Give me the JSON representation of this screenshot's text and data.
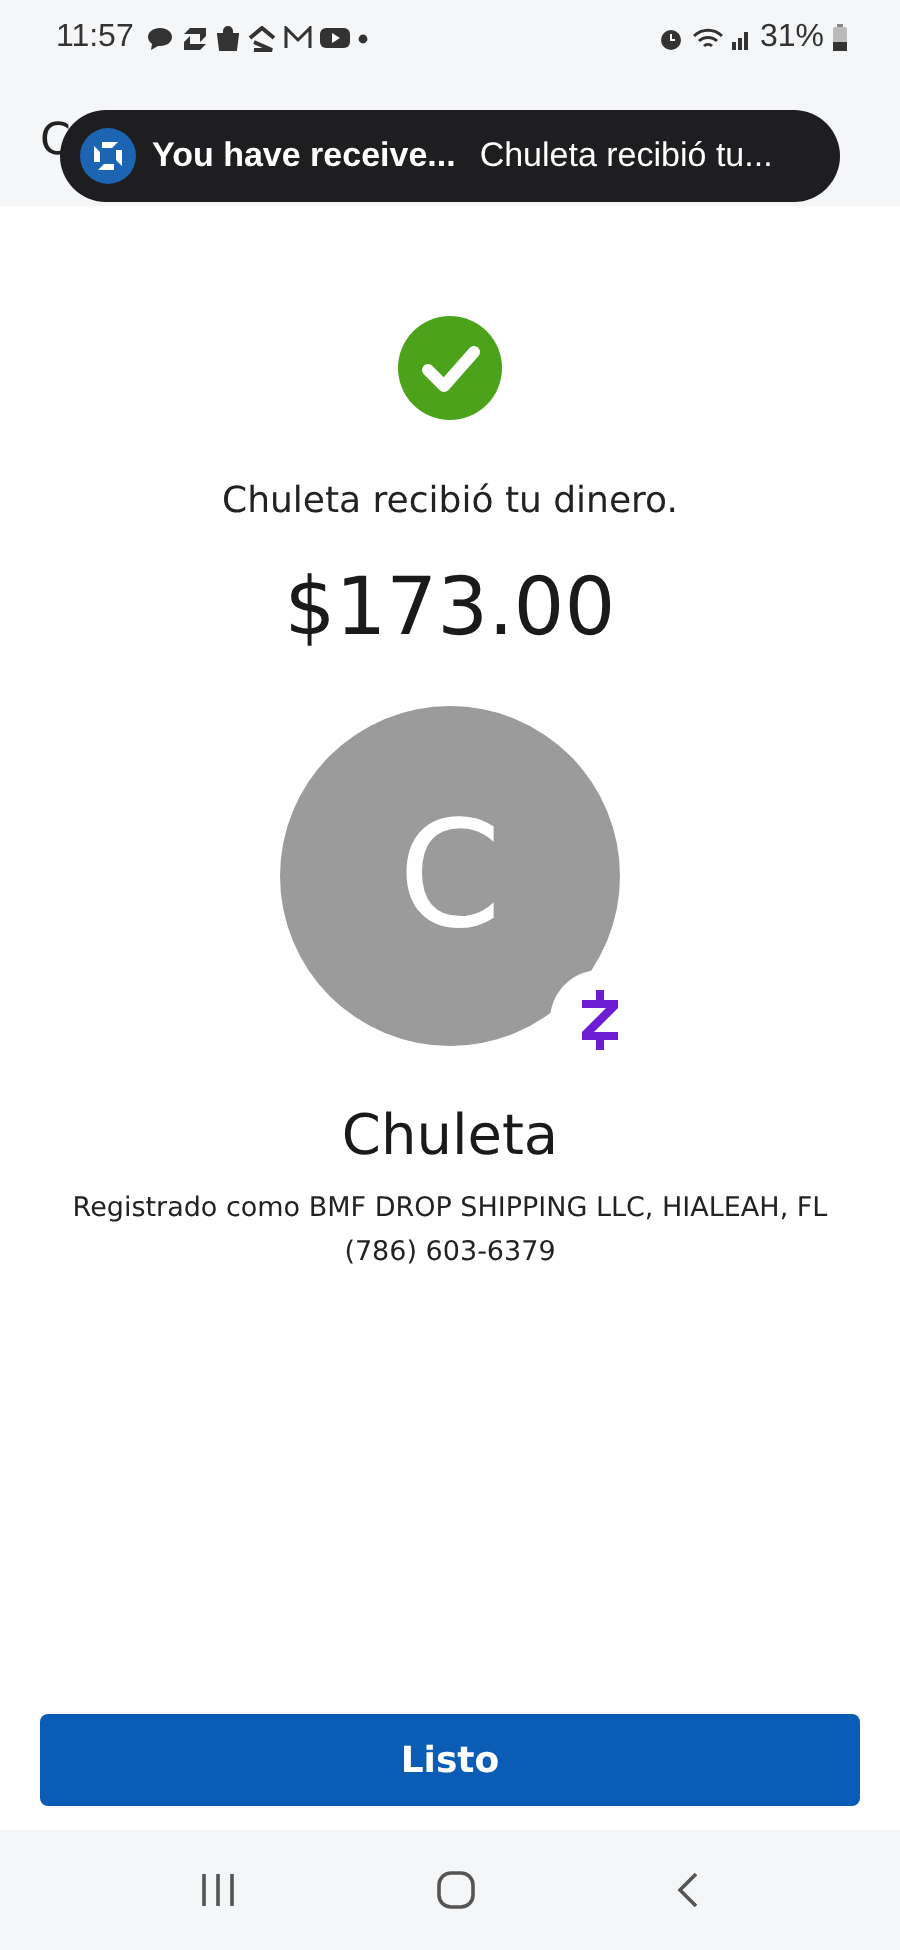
{
  "status_bar": {
    "time": "11:57",
    "battery": "31%"
  },
  "header": {
    "title": "C"
  },
  "notification": {
    "title": "You have receive...",
    "text": "Chuleta recibió tu..."
  },
  "message": "Chuleta recibió tu dinero.",
  "amount": "$173.00",
  "recipient": {
    "initial": "C",
    "name": "Chuleta",
    "registration": "Registrado como BMF DROP SHIPPING LLC, HIALEAH, FL",
    "phone": "(786) 603-6379"
  },
  "button": "Listo"
}
